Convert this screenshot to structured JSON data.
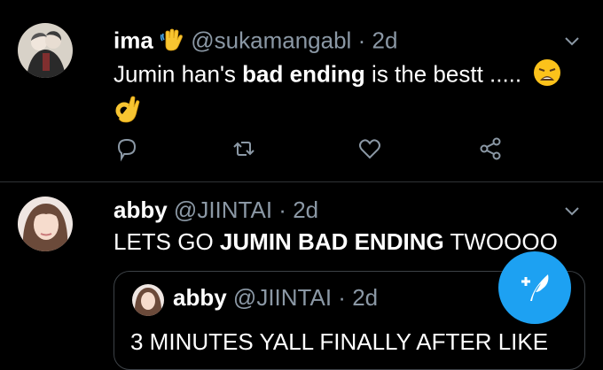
{
  "tweets": [
    {
      "author": "ima",
      "handle": "@sukamangabl",
      "separator": "·",
      "time": "2d",
      "text": {
        "part1": "Jumin",
        "part2": " han's ",
        "part3": "bad ending",
        "part4": " is the bestt ....."
      },
      "icons": [
        "waving-hand-emoji",
        "weary-face-emoji",
        "ok-hand-emoji",
        "reply-icon",
        "retweet-icon",
        "like-icon",
        "share-icon",
        "chevron-down-icon"
      ]
    },
    {
      "author": "abby",
      "handle": "@JIINTAI",
      "separator": "·",
      "time": "2d",
      "text": {
        "part1": "LETS GO ",
        "part2": "JUMIN BAD ENDING",
        "part3": " TWOOOO"
      },
      "quote": {
        "author": "abby",
        "handle": "@JIINTAI",
        "separator": "·",
        "time": "2d",
        "text": "3 MINUTES YALL FINALLY AFTER LIKE"
      }
    }
  ],
  "compose": {
    "icon": "compose-feather-plus-icon"
  },
  "colors": {
    "background": "#000000",
    "secondary_text": "#8b98a5",
    "accent": "#1da1f2",
    "divider": "#2f3336"
  }
}
